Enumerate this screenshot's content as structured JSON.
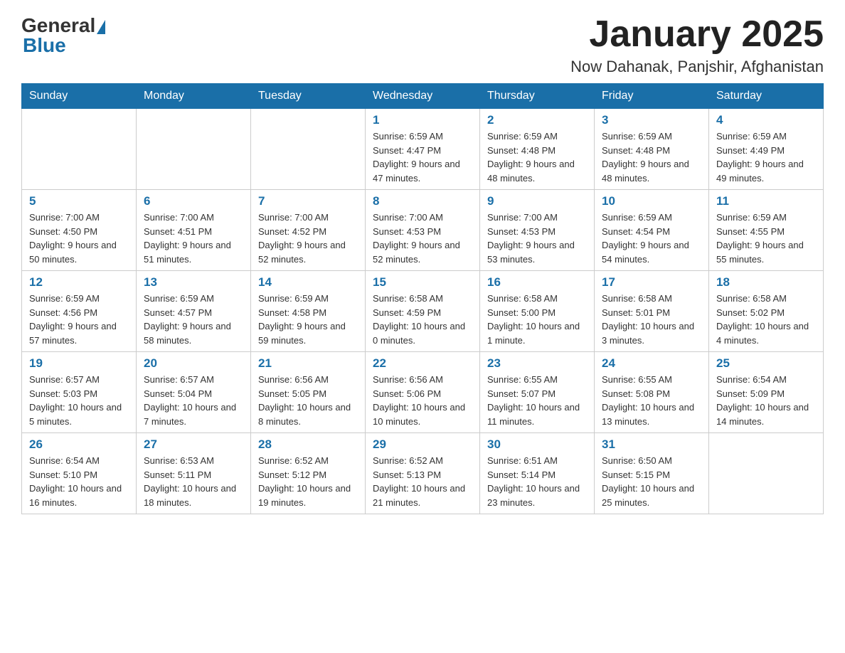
{
  "header": {
    "logo_general": "General",
    "logo_blue": "Blue",
    "title": "January 2025",
    "subtitle": "Now Dahanak, Panjshir, Afghanistan"
  },
  "days_of_week": [
    "Sunday",
    "Monday",
    "Tuesday",
    "Wednesday",
    "Thursday",
    "Friday",
    "Saturday"
  ],
  "weeks": [
    [
      {
        "day": "",
        "sunrise": "",
        "sunset": "",
        "daylight": ""
      },
      {
        "day": "",
        "sunrise": "",
        "sunset": "",
        "daylight": ""
      },
      {
        "day": "",
        "sunrise": "",
        "sunset": "",
        "daylight": ""
      },
      {
        "day": "1",
        "sunrise": "Sunrise: 6:59 AM",
        "sunset": "Sunset: 4:47 PM",
        "daylight": "Daylight: 9 hours and 47 minutes."
      },
      {
        "day": "2",
        "sunrise": "Sunrise: 6:59 AM",
        "sunset": "Sunset: 4:48 PM",
        "daylight": "Daylight: 9 hours and 48 minutes."
      },
      {
        "day": "3",
        "sunrise": "Sunrise: 6:59 AM",
        "sunset": "Sunset: 4:48 PM",
        "daylight": "Daylight: 9 hours and 48 minutes."
      },
      {
        "day": "4",
        "sunrise": "Sunrise: 6:59 AM",
        "sunset": "Sunset: 4:49 PM",
        "daylight": "Daylight: 9 hours and 49 minutes."
      }
    ],
    [
      {
        "day": "5",
        "sunrise": "Sunrise: 7:00 AM",
        "sunset": "Sunset: 4:50 PM",
        "daylight": "Daylight: 9 hours and 50 minutes."
      },
      {
        "day": "6",
        "sunrise": "Sunrise: 7:00 AM",
        "sunset": "Sunset: 4:51 PM",
        "daylight": "Daylight: 9 hours and 51 minutes."
      },
      {
        "day": "7",
        "sunrise": "Sunrise: 7:00 AM",
        "sunset": "Sunset: 4:52 PM",
        "daylight": "Daylight: 9 hours and 52 minutes."
      },
      {
        "day": "8",
        "sunrise": "Sunrise: 7:00 AM",
        "sunset": "Sunset: 4:53 PM",
        "daylight": "Daylight: 9 hours and 52 minutes."
      },
      {
        "day": "9",
        "sunrise": "Sunrise: 7:00 AM",
        "sunset": "Sunset: 4:53 PM",
        "daylight": "Daylight: 9 hours and 53 minutes."
      },
      {
        "day": "10",
        "sunrise": "Sunrise: 6:59 AM",
        "sunset": "Sunset: 4:54 PM",
        "daylight": "Daylight: 9 hours and 54 minutes."
      },
      {
        "day": "11",
        "sunrise": "Sunrise: 6:59 AM",
        "sunset": "Sunset: 4:55 PM",
        "daylight": "Daylight: 9 hours and 55 minutes."
      }
    ],
    [
      {
        "day": "12",
        "sunrise": "Sunrise: 6:59 AM",
        "sunset": "Sunset: 4:56 PM",
        "daylight": "Daylight: 9 hours and 57 minutes."
      },
      {
        "day": "13",
        "sunrise": "Sunrise: 6:59 AM",
        "sunset": "Sunset: 4:57 PM",
        "daylight": "Daylight: 9 hours and 58 minutes."
      },
      {
        "day": "14",
        "sunrise": "Sunrise: 6:59 AM",
        "sunset": "Sunset: 4:58 PM",
        "daylight": "Daylight: 9 hours and 59 minutes."
      },
      {
        "day": "15",
        "sunrise": "Sunrise: 6:58 AM",
        "sunset": "Sunset: 4:59 PM",
        "daylight": "Daylight: 10 hours and 0 minutes."
      },
      {
        "day": "16",
        "sunrise": "Sunrise: 6:58 AM",
        "sunset": "Sunset: 5:00 PM",
        "daylight": "Daylight: 10 hours and 1 minute."
      },
      {
        "day": "17",
        "sunrise": "Sunrise: 6:58 AM",
        "sunset": "Sunset: 5:01 PM",
        "daylight": "Daylight: 10 hours and 3 minutes."
      },
      {
        "day": "18",
        "sunrise": "Sunrise: 6:58 AM",
        "sunset": "Sunset: 5:02 PM",
        "daylight": "Daylight: 10 hours and 4 minutes."
      }
    ],
    [
      {
        "day": "19",
        "sunrise": "Sunrise: 6:57 AM",
        "sunset": "Sunset: 5:03 PM",
        "daylight": "Daylight: 10 hours and 5 minutes."
      },
      {
        "day": "20",
        "sunrise": "Sunrise: 6:57 AM",
        "sunset": "Sunset: 5:04 PM",
        "daylight": "Daylight: 10 hours and 7 minutes."
      },
      {
        "day": "21",
        "sunrise": "Sunrise: 6:56 AM",
        "sunset": "Sunset: 5:05 PM",
        "daylight": "Daylight: 10 hours and 8 minutes."
      },
      {
        "day": "22",
        "sunrise": "Sunrise: 6:56 AM",
        "sunset": "Sunset: 5:06 PM",
        "daylight": "Daylight: 10 hours and 10 minutes."
      },
      {
        "day": "23",
        "sunrise": "Sunrise: 6:55 AM",
        "sunset": "Sunset: 5:07 PM",
        "daylight": "Daylight: 10 hours and 11 minutes."
      },
      {
        "day": "24",
        "sunrise": "Sunrise: 6:55 AM",
        "sunset": "Sunset: 5:08 PM",
        "daylight": "Daylight: 10 hours and 13 minutes."
      },
      {
        "day": "25",
        "sunrise": "Sunrise: 6:54 AM",
        "sunset": "Sunset: 5:09 PM",
        "daylight": "Daylight: 10 hours and 14 minutes."
      }
    ],
    [
      {
        "day": "26",
        "sunrise": "Sunrise: 6:54 AM",
        "sunset": "Sunset: 5:10 PM",
        "daylight": "Daylight: 10 hours and 16 minutes."
      },
      {
        "day": "27",
        "sunrise": "Sunrise: 6:53 AM",
        "sunset": "Sunset: 5:11 PM",
        "daylight": "Daylight: 10 hours and 18 minutes."
      },
      {
        "day": "28",
        "sunrise": "Sunrise: 6:52 AM",
        "sunset": "Sunset: 5:12 PM",
        "daylight": "Daylight: 10 hours and 19 minutes."
      },
      {
        "day": "29",
        "sunrise": "Sunrise: 6:52 AM",
        "sunset": "Sunset: 5:13 PM",
        "daylight": "Daylight: 10 hours and 21 minutes."
      },
      {
        "day": "30",
        "sunrise": "Sunrise: 6:51 AM",
        "sunset": "Sunset: 5:14 PM",
        "daylight": "Daylight: 10 hours and 23 minutes."
      },
      {
        "day": "31",
        "sunrise": "Sunrise: 6:50 AM",
        "sunset": "Sunset: 5:15 PM",
        "daylight": "Daylight: 10 hours and 25 minutes."
      },
      {
        "day": "",
        "sunrise": "",
        "sunset": "",
        "daylight": ""
      }
    ]
  ]
}
